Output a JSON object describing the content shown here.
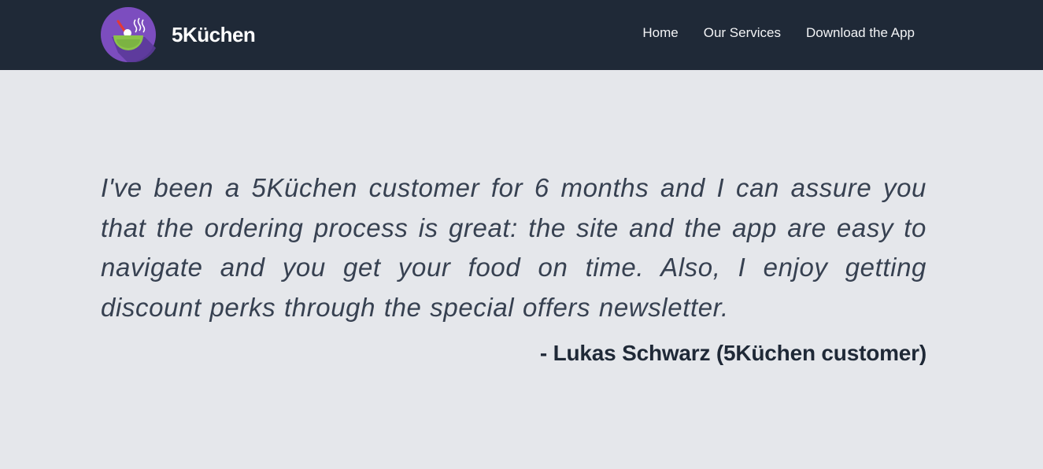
{
  "brand": {
    "name": "5Küchen",
    "logo_icon": "soup-bowl-icon",
    "logo_colors": {
      "circle": "#7c4dbf",
      "shadow": "#5b3a99",
      "bowl": "#8bc34a",
      "spoon": "#e53935"
    }
  },
  "nav": {
    "items": [
      {
        "label": "Home"
      },
      {
        "label": "Our Services"
      },
      {
        "label": "Download the App"
      }
    ]
  },
  "testimonial": {
    "quote": "I've been a 5Küchen customer for 6 months and I can assure you that the ordering process is great: the site and the app are easy to navigate and you get your food on time. Also, I enjoy getting discount perks through the special offers newsletter.",
    "author": "- Lukas Schwarz (5Küchen customer)"
  },
  "colors": {
    "navbar_bg": "#1f2937",
    "page_bg": "#e5e7eb",
    "text": "#374151"
  }
}
